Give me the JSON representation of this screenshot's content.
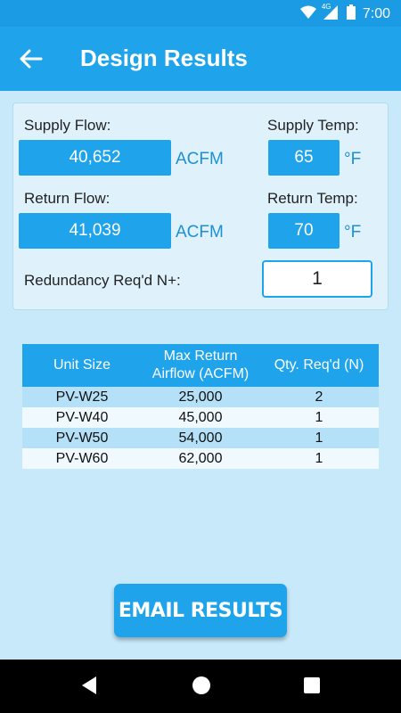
{
  "status_bar": {
    "time": "7:00",
    "network": "4G"
  },
  "app_bar": {
    "title": "Design Results"
  },
  "form": {
    "supply_flow_label": "Supply Flow:",
    "supply_flow_value": "40,652",
    "supply_flow_unit": "ACFM",
    "supply_temp_label": "Supply Temp:",
    "supply_temp_value": "65",
    "supply_temp_unit": "°F",
    "return_flow_label": "Return Flow:",
    "return_flow_value": "41,039",
    "return_flow_unit": "ACFM",
    "return_temp_label": "Return Temp:",
    "return_temp_value": "70",
    "return_temp_unit": "°F",
    "redundancy_label": "Redundancy Req'd N+:",
    "redundancy_value": "1"
  },
  "table": {
    "headers": [
      "Unit Size",
      "Max Return Airflow (ACFM)",
      "Qty. Req'd (N)"
    ],
    "rows": [
      [
        "PV-W25",
        "25,000",
        "2"
      ],
      [
        "PV-W40",
        "45,000",
        "1"
      ],
      [
        "PV-W50",
        "54,000",
        "1"
      ],
      [
        "PV-W60",
        "62,000",
        "1"
      ]
    ]
  },
  "email_button": {
    "label": "EMAIL RESULTS"
  },
  "colors": {
    "primary": "#1fa4ec",
    "status_bar": "#1a9be3",
    "background": "#c7e9fa",
    "row_dark": "#b4e1f8",
    "row_light": "#f0f9fd"
  }
}
